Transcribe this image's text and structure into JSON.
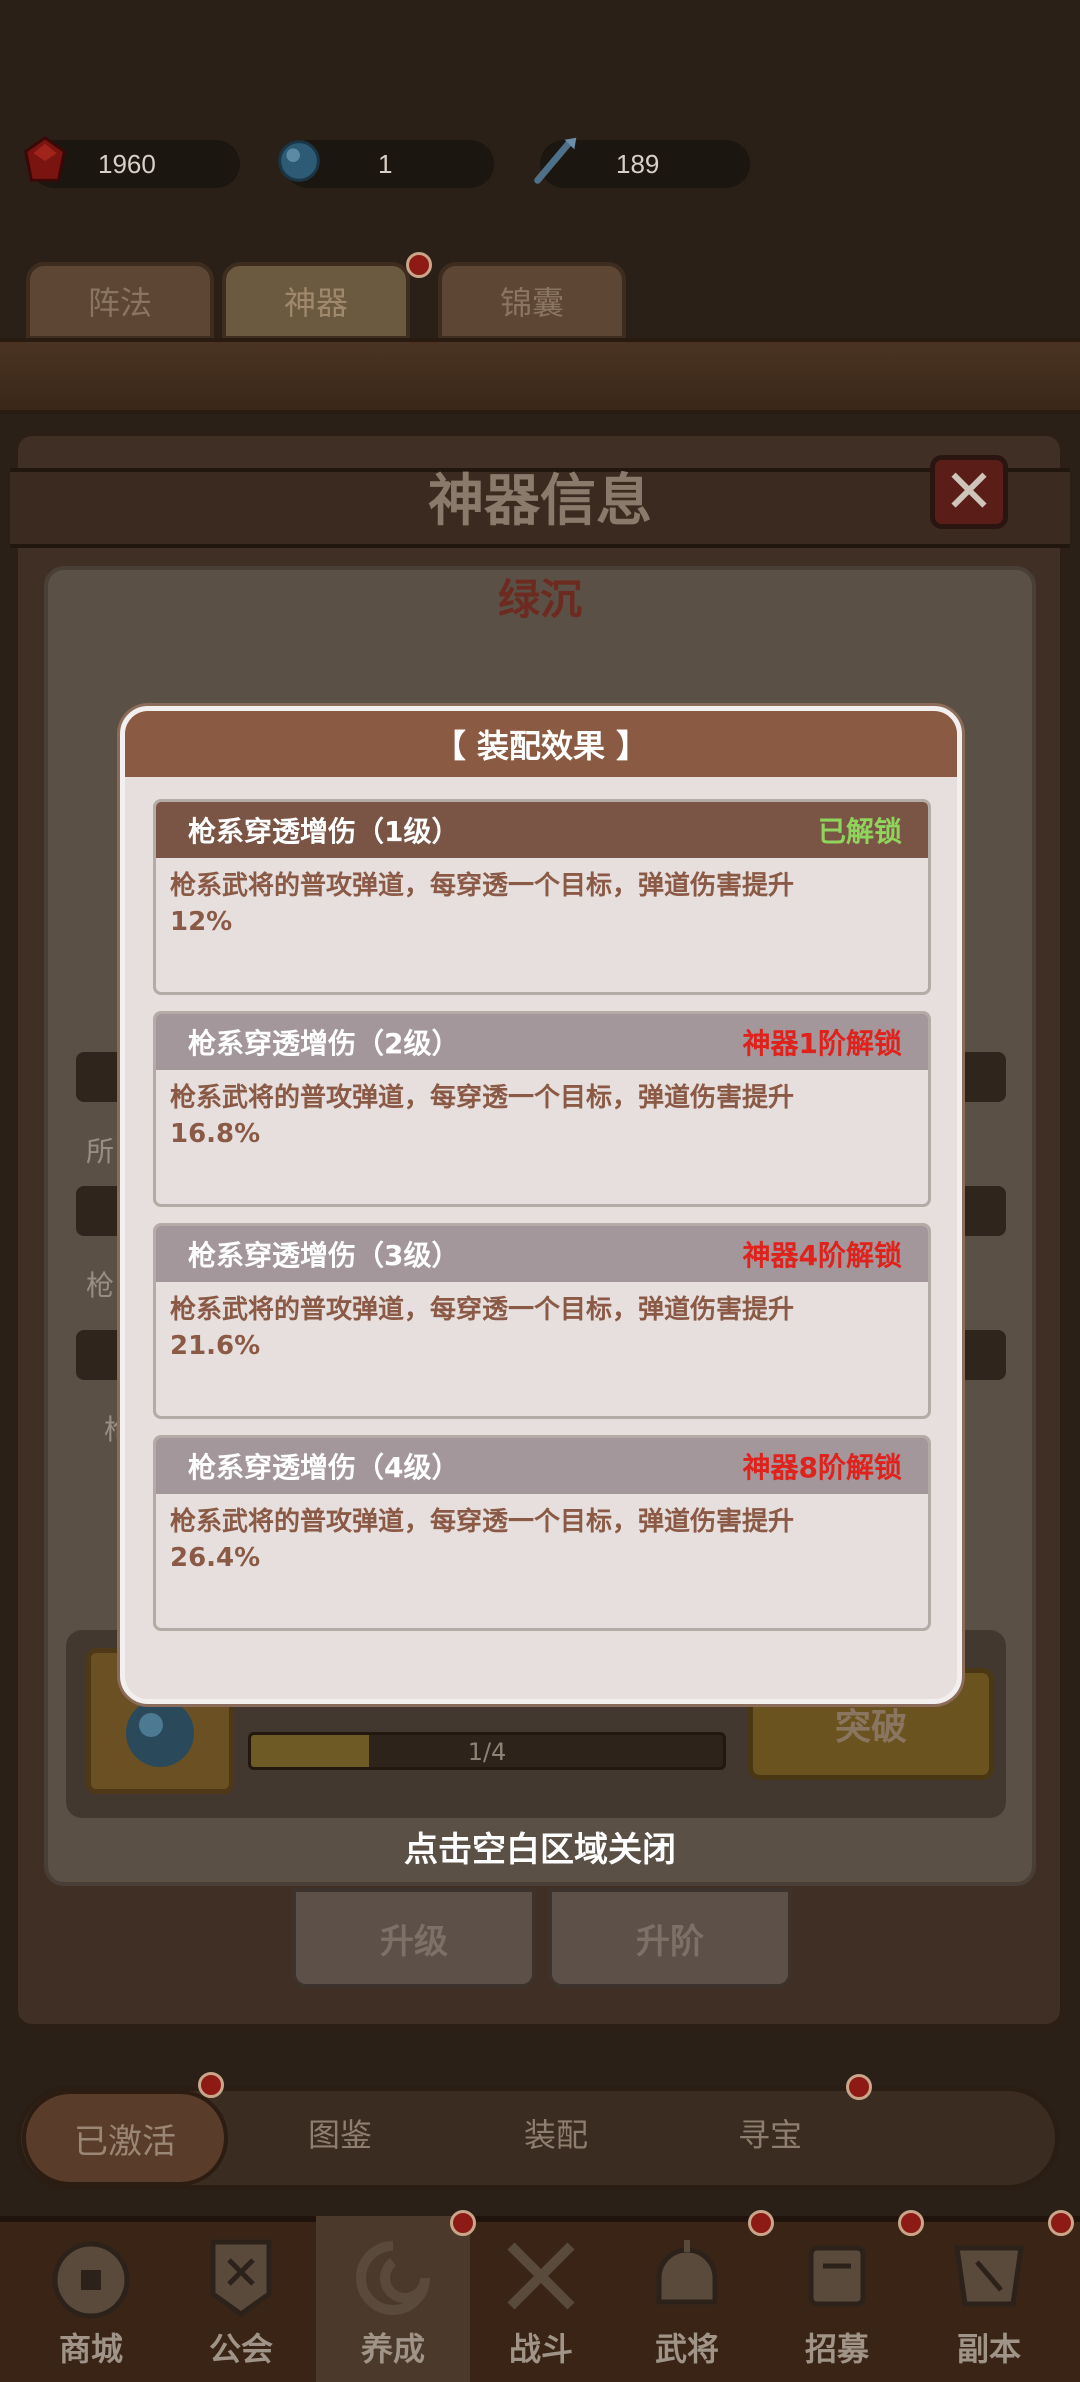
{
  "resources": [
    {
      "icon": "red-gem-icon",
      "value": "1960"
    },
    {
      "icon": "blue-orb-icon",
      "value": "1"
    },
    {
      "icon": "spear-icon",
      "value": "189"
    }
  ],
  "top_tabs": [
    {
      "label": "阵法",
      "active": false
    },
    {
      "label": "神器",
      "active": true
    },
    {
      "label": "锦囊",
      "active": false
    }
  ],
  "artifact_panel": {
    "title": "神器信息",
    "close_label": "✕",
    "artifact_name": "绿沉",
    "partial_labels": [
      "所",
      "枪",
      "枪"
    ],
    "progress": {
      "text": "1/4",
      "fraction": 0.25
    },
    "breakthrough_label": "突破",
    "sub_tabs": [
      "升级",
      "升阶"
    ]
  },
  "segment_bar": {
    "items": [
      "已激活",
      "图鉴",
      "装配",
      "寻宝"
    ],
    "active_index": 0
  },
  "bottom_nav": [
    {
      "label": "商城",
      "icon": "shop-coin-icon"
    },
    {
      "label": "公会",
      "icon": "guild-banner-icon"
    },
    {
      "label": "养成",
      "icon": "swirl-icon",
      "active": true
    },
    {
      "label": "战斗",
      "icon": "crossed-swords-icon"
    },
    {
      "label": "武将",
      "icon": "helmet-icon"
    },
    {
      "label": "招募",
      "icon": "recruit-flag-icon"
    },
    {
      "label": "副本",
      "icon": "dungeon-flag-icon"
    }
  ],
  "modal": {
    "title": "【 装配效果 】",
    "cards": [
      {
        "title": "枪系穿透增伤（1级）",
        "status": "已解锁",
        "status_color": "#8fd45c",
        "unlocked": true,
        "line1": "枪系武将的普攻弹道，每穿透一个目标，弹道伤害提升",
        "line2": "12%"
      },
      {
        "title": "枪系穿透增伤（2级）",
        "status": "神器1阶解锁",
        "status_color": "#e0221c",
        "unlocked": false,
        "line1": "枪系武将的普攻弹道，每穿透一个目标，弹道伤害提升",
        "line2": "16.8%"
      },
      {
        "title": "枪系穿透增伤（3级）",
        "status": "神器4阶解锁",
        "status_color": "#e0221c",
        "unlocked": false,
        "line1": "枪系武将的普攻弹道，每穿透一个目标，弹道伤害提升",
        "line2": "21.6%"
      },
      {
        "title": "枪系穿透增伤（4级）",
        "status": "神器8阶解锁",
        "status_color": "#e0221c",
        "unlocked": false,
        "line1": "枪系武将的普攻弹道，每穿透一个目标，弹道伤害提升",
        "line2": "26.4%"
      }
    ],
    "close_hint": "点击空白区域关闭"
  }
}
